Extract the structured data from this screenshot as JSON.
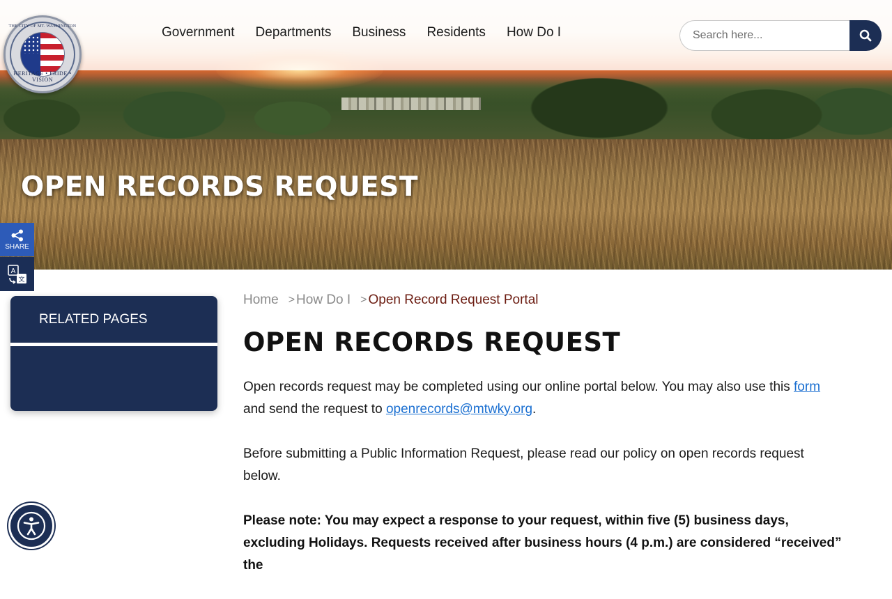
{
  "logo": {
    "arc_text": "THE CITY OF MT. WASHINGTON",
    "motto": "HERITAGE • PRIDE • VISION"
  },
  "nav": {
    "items": [
      {
        "label": "Government"
      },
      {
        "label": "Departments"
      },
      {
        "label": "Business"
      },
      {
        "label": "Residents"
      },
      {
        "label": "How Do I"
      }
    ]
  },
  "search": {
    "placeholder": "Search here...",
    "icon": "search-icon"
  },
  "hero": {
    "title": "OPEN RECORDS REQUEST"
  },
  "side_tools": {
    "share_label": "SHARE",
    "share_icon": "share-icon",
    "translate_icon": "translate-icon"
  },
  "related": {
    "header": "RELATED PAGES"
  },
  "breadcrumb": {
    "home": "Home",
    "sep": ">",
    "parent": "How Do I",
    "current": "Open Record Request Portal"
  },
  "page": {
    "title": "OPEN RECORDS REQUEST",
    "p1_text": "Open records request may be completed using our online portal below.  You may also use this ",
    "p1_link": "form",
    "p1_text2": " and send the request to ",
    "p1_email": "openrecords@mtwky.org",
    "p1_end": ".",
    "p2": "Before submitting a Public Information Request, please read our policy on open records request below.",
    "p3": "Please note: You may expect a response to your request, within five (5) business days, excluding Holidays. Requests received after business hours (4 p.m.) are considered “received” the"
  },
  "accessibility": {
    "icon": "accessibility-icon"
  },
  "colors": {
    "navy": "#1c2e54",
    "share_blue": "#2d5bb8",
    "link": "#1a6fd1",
    "breadcrumb_current": "#6b1b10"
  }
}
